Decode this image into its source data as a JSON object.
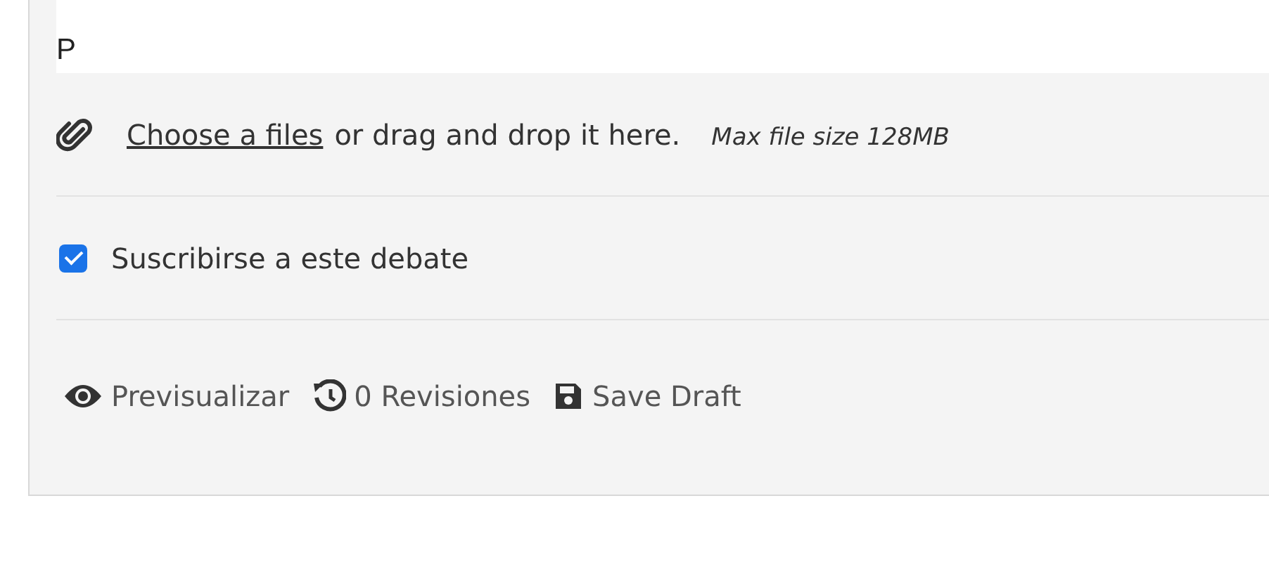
{
  "editor": {
    "value": "P"
  },
  "attachment": {
    "link": "Choose a files",
    "text": "or drag and drop it here.",
    "note": "Max file size 128MB"
  },
  "subscribe": {
    "label": "Suscribirse a este debate",
    "checked": true
  },
  "actions": [
    {
      "kind": "preview",
      "label": "Previsualizar"
    },
    {
      "kind": "history",
      "label": "0 Revisiones"
    },
    {
      "kind": "save",
      "label": "Save Draft"
    }
  ]
}
